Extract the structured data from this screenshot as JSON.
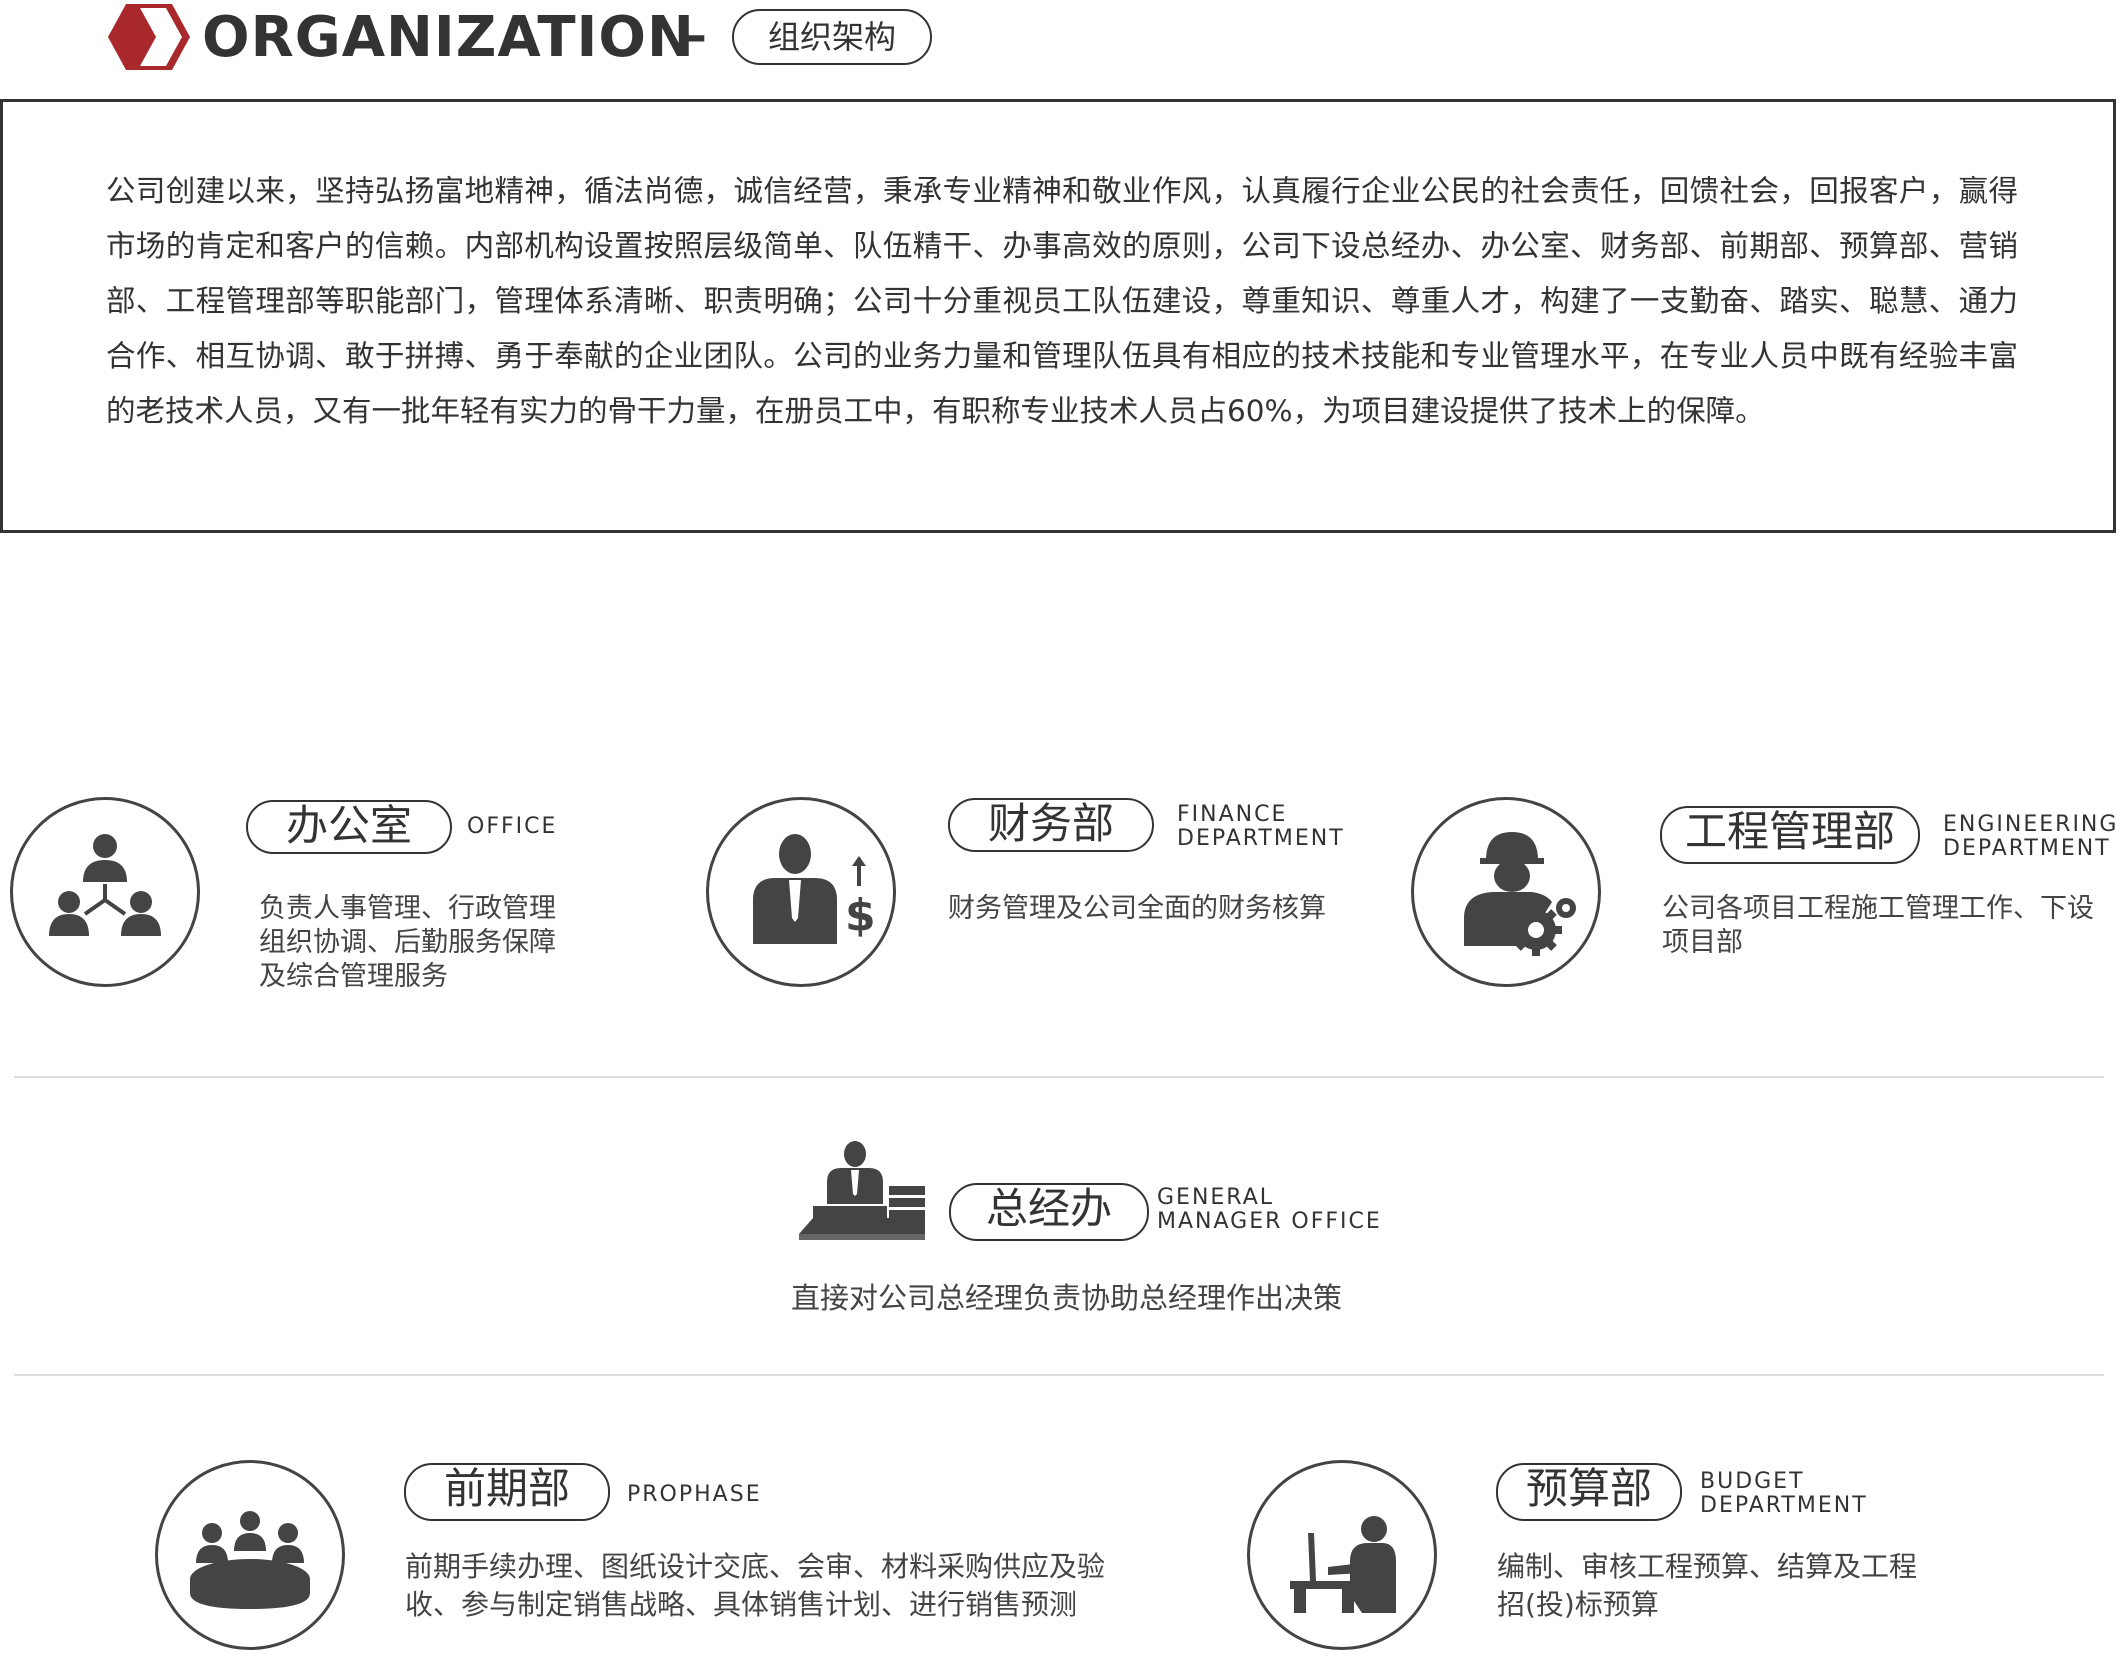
{
  "header": {
    "title": "ORGANIZATION",
    "dash": "–",
    "subtitle": "组织架构",
    "accent_color": "#a8282b"
  },
  "intro": {
    "text": "公司创建以来，坚持弘扬富地精神，循法尚德，诚信经营，秉承专业精神和敬业作风，认真履行企业公民的社会责任，回馈社会，回报客户，赢得市场的肯定和客户的信赖。内部机构设置按照层级简单、队伍精干、办事高效的原则，公司下设总经办、办公室、财务部、前期部、预算部、营销部、工程管理部等职能部门，管理体系清晰、职责明确；公司十分重视员工队伍建设，尊重知识、尊重人才，构建了一支勤奋、踏实、聪慧、通力合作、相互协调、敢于拼搏、勇于奉献的企业团队。公司的业务力量和管理队伍具有相应的技术技能和专业管理水平，在专业人员中既有经验丰富的老技术人员，又有一批年轻有实力的骨干力量，在册员工中，有职称专业技术人员占60%，为项目建设提供了技术上的保障。"
  },
  "departments": {
    "office": {
      "name": "办公室",
      "en1": "OFFICE",
      "desc1": "负责人事管理、行政管理",
      "desc2": "组织协调、后勤服务保障",
      "desc3": "及综合管理服务",
      "icon": "team-hierarchy-icon"
    },
    "finance": {
      "name": "财务部",
      "en1": "FINANCE",
      "en2": "DEPARTMENT",
      "desc1": "财务管理及公司全面的财务核算",
      "icon": "businessman-dollar-icon"
    },
    "engineering": {
      "name": "工程管理部",
      "en1": "ENGINEERING",
      "en2": "DEPARTMENT",
      "desc1": "公司各项目工程施工管理工作、下设",
      "desc2": "项目部",
      "icon": "worker-gear-icon"
    },
    "general": {
      "name": "总经办",
      "en1": "GENERAL",
      "en2": "MANAGER OFFICE",
      "desc1": "直接对公司总经理负责协助总经理作出决策",
      "icon": "manager-desk-icon"
    },
    "prophase": {
      "name": "前期部",
      "en1": "PROPHASE",
      "desc1": "前期手续办理、图纸设计交底、会审、材料采购供应及验",
      "desc2": "收、参与制定销售战略、具体销售计划、进行销售预测",
      "icon": "meeting-table-icon"
    },
    "budget": {
      "name": "预算部",
      "en1": "BUDGET",
      "en2": "DEPARTMENT",
      "desc1": "编制、审核工程预算、结算及工程",
      "desc2": "招(投)标预算",
      "icon": "computer-user-icon"
    }
  }
}
